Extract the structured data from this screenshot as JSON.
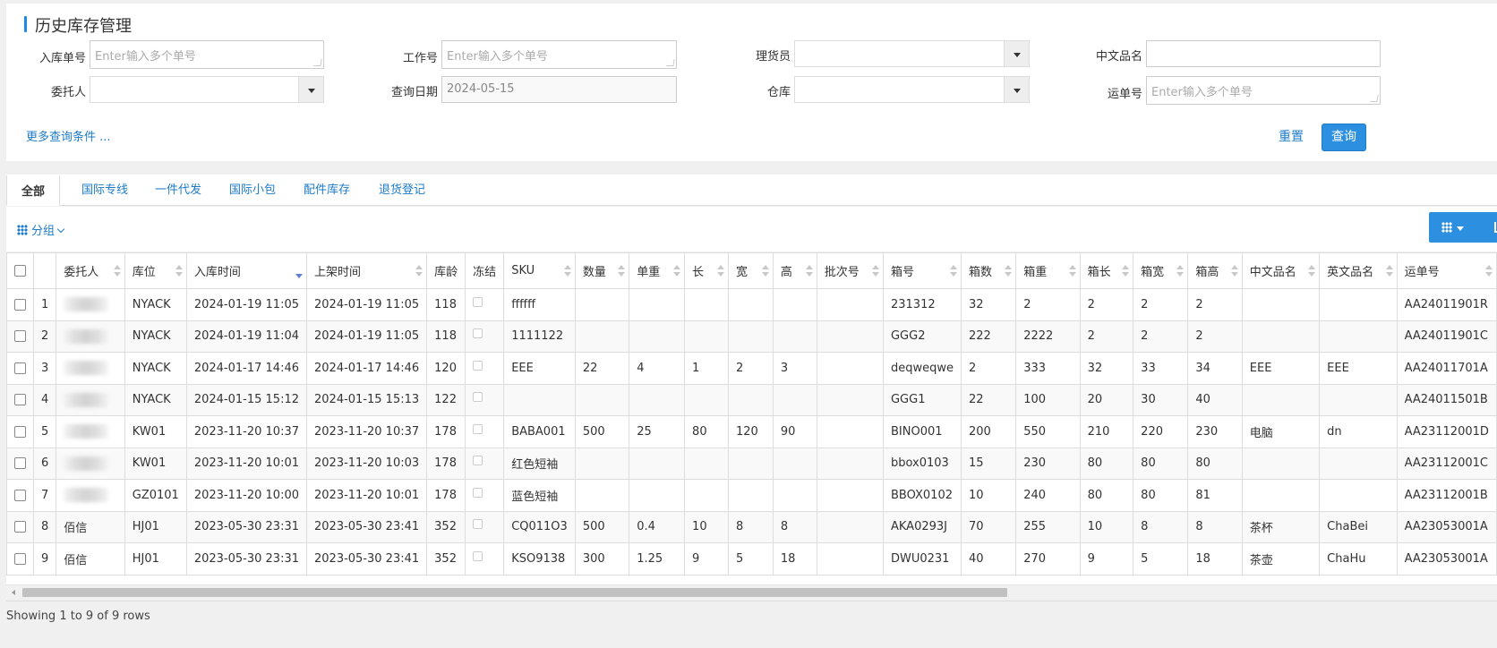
{
  "header": {
    "title": "历史库存管理"
  },
  "query": {
    "inbound_no_label": "入库单号",
    "inbound_no_placeholder": "Enter输入多个单号",
    "work_no_label": "工作号",
    "work_no_placeholder": "Enter输入多个单号",
    "tally_label": "理货员",
    "cn_name_label": "中文品名",
    "consignor_label": "委托人",
    "query_date_label": "查询日期",
    "query_date_value": "2024-05-15",
    "warehouse_label": "仓库",
    "waybill_label": "运单号",
    "waybill_placeholder": "Enter输入多个单号",
    "more_conditions": "更多查询条件 ...",
    "reset_label": "重置",
    "search_label": "查询"
  },
  "tabs": [
    {
      "label": "全部",
      "active": true
    },
    {
      "label": "国际专线"
    },
    {
      "label": "一件代发"
    },
    {
      "label": "国际小包"
    },
    {
      "label": "配件库存"
    },
    {
      "label": "退货登记"
    }
  ],
  "toolbar": {
    "group_label": "分组"
  },
  "table": {
    "headers": [
      "",
      "",
      "委托人",
      "库位",
      "入库时间",
      "上架时间",
      "库龄",
      "冻结",
      "SKU",
      "数量",
      "单重",
      "长",
      "宽",
      "高",
      "批次号",
      "箱号",
      "箱数",
      "箱重",
      "箱长",
      "箱宽",
      "箱高",
      "中文品名",
      "英文品名",
      "运单号"
    ],
    "rows": [
      [
        "1",
        "",
        "NYACK",
        "2024-01-19 11:05",
        "2024-01-19 11:05",
        "118",
        "",
        "ffffff",
        "",
        "",
        "",
        "",
        "",
        "",
        "231312",
        "32",
        "2",
        "2",
        "2",
        "2",
        "",
        "",
        "AA24011901R"
      ],
      [
        "2",
        "",
        "NYACK",
        "2024-01-19 11:04",
        "2024-01-19 11:05",
        "118",
        "",
        "1111122",
        "",
        "",
        "",
        "",
        "",
        "",
        "GGG2",
        "222",
        "2222",
        "2",
        "2",
        "2",
        "",
        "",
        "AA24011901C"
      ],
      [
        "3",
        "",
        "NYACK",
        "2024-01-17 14:46",
        "2024-01-17 14:46",
        "120",
        "",
        "EEE",
        "22",
        "4",
        "1",
        "2",
        "3",
        "",
        "deqweqwe",
        "2",
        "333",
        "32",
        "33",
        "34",
        "EEE",
        "EEE",
        "AA24011701A"
      ],
      [
        "4",
        "",
        "NYACK",
        "2024-01-15 15:12",
        "2024-01-15 15:13",
        "122",
        "",
        "",
        "",
        "",
        "",
        "",
        "",
        "",
        "GGG1",
        "22",
        "100",
        "20",
        "30",
        "40",
        "",
        "",
        "AA24011501B"
      ],
      [
        "5",
        "",
        "KW01",
        "2023-11-20 10:37",
        "2023-11-20 10:37",
        "178",
        "",
        "BABA001",
        "500",
        "25",
        "80",
        "120",
        "90",
        "",
        "BINO001",
        "200",
        "550",
        "210",
        "220",
        "230",
        "电脑",
        "dn",
        "AA23112001D"
      ],
      [
        "6",
        "",
        "KW01",
        "2023-11-20 10:01",
        "2023-11-20 10:03",
        "178",
        "",
        "红色短袖",
        "",
        "",
        "",
        "",
        "",
        "",
        "bbox0103",
        "15",
        "230",
        "80",
        "80",
        "80",
        "",
        "",
        "AA23112001C"
      ],
      [
        "7",
        "",
        "GZ0101",
        "2023-11-20 10:00",
        "2023-11-20 10:01",
        "178",
        "",
        "蓝色短袖",
        "",
        "",
        "",
        "",
        "",
        "",
        "BBOX0102",
        "10",
        "240",
        "80",
        "80",
        "81",
        "",
        "",
        "AA23112001B"
      ],
      [
        "8",
        "佰信",
        "HJ01",
        "2023-05-30 23:31",
        "2023-05-30 23:41",
        "352",
        "",
        "CQ011O3",
        "500",
        "0.4",
        "10",
        "8",
        "8",
        "",
        "AKA0293J",
        "70",
        "255",
        "10",
        "8",
        "8",
        "茶杯",
        "ChaBei",
        "AA23053001A"
      ],
      [
        "9",
        "佰信",
        "HJ01",
        "2023-05-30 23:31",
        "2023-05-30 23:41",
        "352",
        "",
        "KSO9138",
        "300",
        "1.25",
        "9",
        "5",
        "18",
        "",
        "DWU0231",
        "40",
        "270",
        "9",
        "5",
        "18",
        "茶壶",
        "ChaHu",
        "AA23053001A"
      ]
    ]
  },
  "footer": {
    "status": "Showing 1 to 9 of 9 rows"
  },
  "colors": {
    "accent": "#2d8fe0",
    "link": "#1e7bc7"
  }
}
